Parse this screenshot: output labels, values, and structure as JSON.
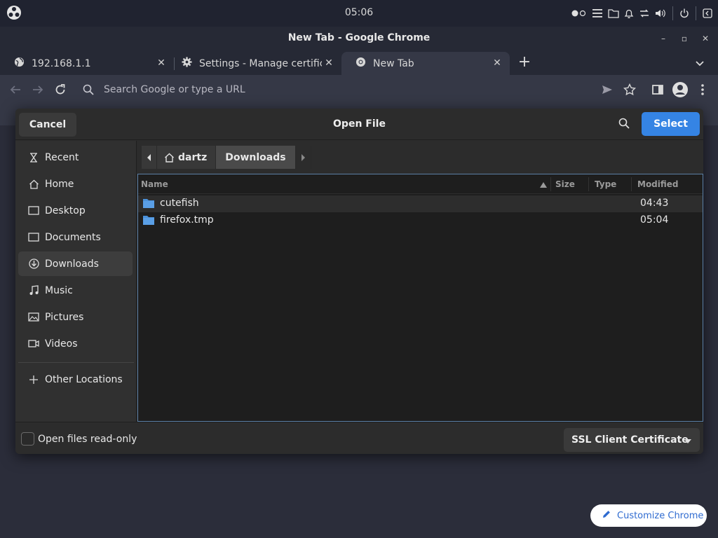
{
  "system": {
    "clock": "05:06"
  },
  "window": {
    "title": "New Tab - Google Chrome",
    "minimize": "–",
    "maximize": "▫",
    "close": "✕"
  },
  "tabs": [
    {
      "label": "192.168.1.1",
      "icon": "globe-icon"
    },
    {
      "label": "Settings - Manage certificates",
      "icon": "gear-icon"
    },
    {
      "label": "New Tab",
      "icon": "chrome-icon",
      "active": true
    }
  ],
  "toolbar": {
    "omnibox_placeholder": "Search Google or type a URL"
  },
  "page": {
    "customize_label": "Customize Chrome"
  },
  "dialog": {
    "title": "Open File",
    "cancel_label": "Cancel",
    "select_label": "Select",
    "sidebar": [
      {
        "label": "Recent",
        "icon": "clock-icon"
      },
      {
        "label": "Home",
        "icon": "home-icon"
      },
      {
        "label": "Desktop",
        "icon": "desktop-icon"
      },
      {
        "label": "Documents",
        "icon": "document-icon"
      },
      {
        "label": "Downloads",
        "icon": "download-icon",
        "selected": true
      },
      {
        "label": "Music",
        "icon": "music-icon"
      },
      {
        "label": "Pictures",
        "icon": "picture-icon"
      },
      {
        "label": "Videos",
        "icon": "video-icon"
      }
    ],
    "other_locations": "Other Locations",
    "pathbar": {
      "home": "dartz",
      "current": "Downloads"
    },
    "columns": {
      "name": "Name",
      "size": "Size",
      "type": "Type",
      "modified": "Modified"
    },
    "files": [
      {
        "name": "cutefish",
        "size": "",
        "type": "",
        "modified": "04:43"
      },
      {
        "name": "firefox.tmp",
        "size": "",
        "type": "",
        "modified": "05:04"
      }
    ],
    "readonly_label": "Open files read-only",
    "filter_label": "SSL Client Certificate"
  },
  "colors": {
    "accent": "#3584e4",
    "folder": "#4a90d9",
    "link": "#2f6bd0"
  }
}
